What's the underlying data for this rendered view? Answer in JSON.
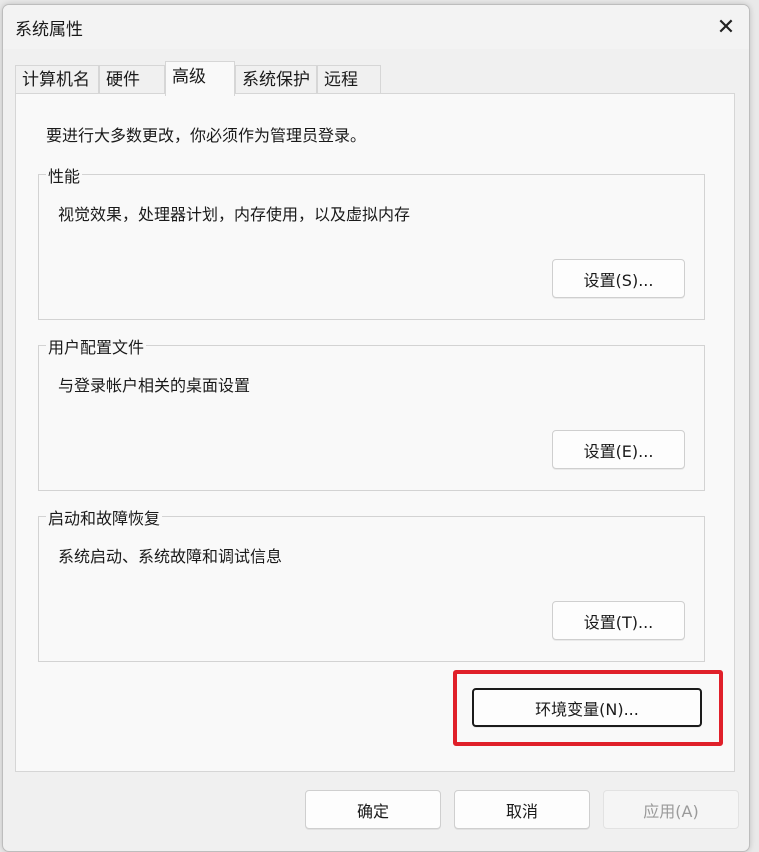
{
  "window": {
    "title": "系统属性",
    "close_glyph": "✕"
  },
  "tabs": [
    {
      "label": "计算机名"
    },
    {
      "label": "硬件"
    },
    {
      "label": "高级",
      "active": true
    },
    {
      "label": "系统保护"
    },
    {
      "label": "远程"
    }
  ],
  "admin_note": "要进行大多数更改，你必须作为管理员登录。",
  "groups": {
    "performance": {
      "title": "性能",
      "description": "视觉效果，处理器计划，内存使用，以及虚拟内存",
      "button": "设置(S)..."
    },
    "user_profiles": {
      "title": "用户配置文件",
      "description": "与登录帐户相关的桌面设置",
      "button": "设置(E)..."
    },
    "startup_recovery": {
      "title": "启动和故障恢复",
      "description": "系统启动、系统故障和调试信息",
      "button": "设置(T)..."
    }
  },
  "env_button": "环境变量(N)...",
  "footer": {
    "ok": "确定",
    "cancel": "取消",
    "apply": "应用(A)"
  },
  "colors": {
    "highlight": "#e0202a",
    "window_bg": "#f0f0f0",
    "panel_bg": "#f9f9f9"
  }
}
